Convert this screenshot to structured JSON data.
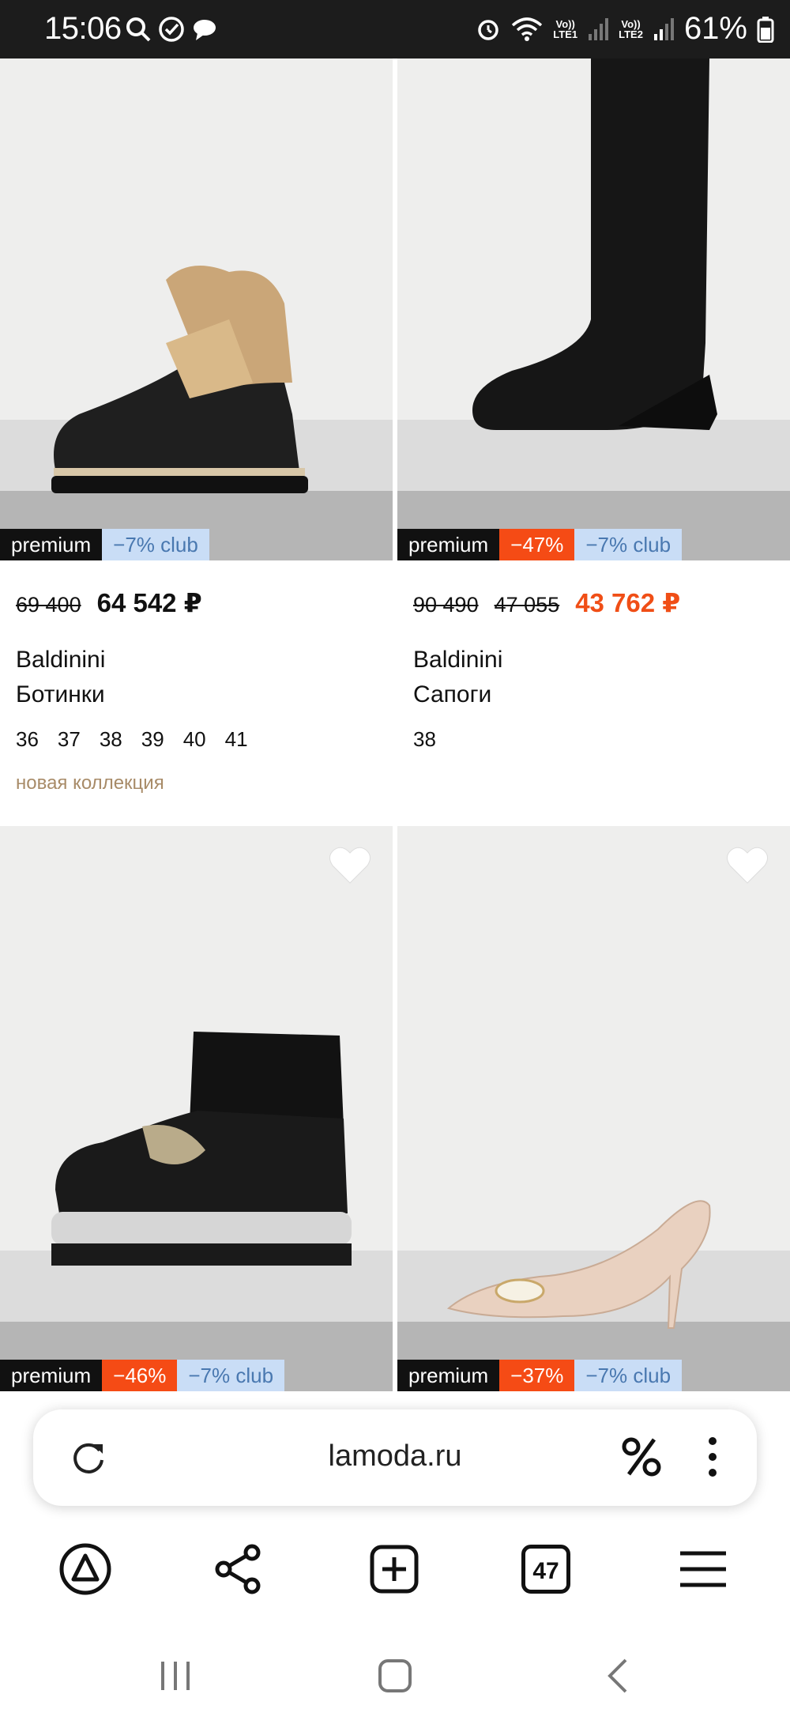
{
  "status_bar": {
    "time": "15:06",
    "battery": "61%",
    "sim1_top": "Vo))",
    "sim1_bottom": "LTE1",
    "sim2_top": "Vo))",
    "sim2_bottom": "LTE2",
    "icons": [
      "search-icon",
      "check-circle-icon",
      "chat-icon",
      "alarm-icon",
      "wifi-icon",
      "signal-icon",
      "battery-icon"
    ]
  },
  "products": [
    {
      "badges": {
        "premium": "premium",
        "sale": "",
        "club": "−7% club"
      },
      "old_price": "69 400",
      "old_price_2": "",
      "price": "64 542 ₽",
      "brand": "Baldinini",
      "type": "Ботинки",
      "sizes": [
        "36",
        "37",
        "38",
        "39",
        "40",
        "41"
      ],
      "tag": "новая коллекция"
    },
    {
      "badges": {
        "premium": "premium",
        "sale": "−47%",
        "club": "−7% club"
      },
      "old_price": "90 490",
      "old_price_2": "47 055",
      "price": "43 762 ₽",
      "brand": "Baldinini",
      "type": "Сапоги",
      "sizes": [
        "38"
      ],
      "tag": ""
    },
    {
      "badges": {
        "premium": "premium",
        "sale": "−46%",
        "club": "−7% club"
      }
    },
    {
      "badges": {
        "premium": "premium",
        "sale": "−37%",
        "club": "−7% club"
      }
    }
  ],
  "browser": {
    "url": "lamoda.ru",
    "tabs_count": "47"
  },
  "colors": {
    "sale": "#f54b15",
    "club_bg": "#c9ddf6",
    "club_text": "#4978b0",
    "tag": "#a88b68"
  }
}
